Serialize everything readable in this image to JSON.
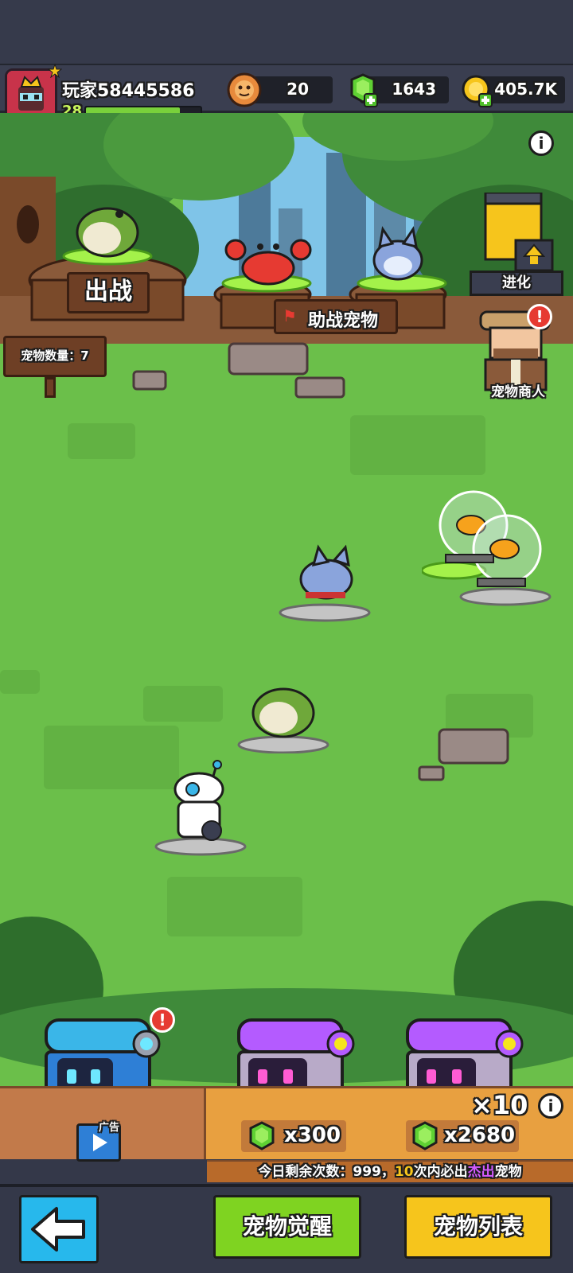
{
  "header": {
    "player_name": "玩家58445586",
    "level": "28",
    "xp_fraction": 0.82,
    "currencies": [
      {
        "icon": "pet-food-icon",
        "value": "20"
      },
      {
        "icon": "green-gem-icon",
        "value": "1643"
      },
      {
        "icon": "gold-coin-icon",
        "value": "405.7K"
      }
    ]
  },
  "scene": {
    "deploy_label": "出战",
    "assist_label": "助战宠物",
    "pet_count_label": "宠物数量：7",
    "evolve_label": "进化",
    "merchant_label": "宠物商人"
  },
  "chests": {
    "ad_label": "广告",
    "price_single": "x300",
    "price_ten": "x2680",
    "ten_multiplier": "×10",
    "remaining_prefix": "今日剩余次数：999，",
    "guarantee_count": "10",
    "guarantee_mid": "次内必出",
    "guarantee_quality": "杰出",
    "guarantee_suffix": "宠物"
  },
  "footer": {
    "awaken_label": "宠物觉醒",
    "list_label": "宠物列表"
  },
  "colors": {
    "grass": "#6bbf4a",
    "wood": "#6e3f25",
    "awaken_btn": "#7fd321",
    "list_btn": "#f6c51c",
    "back_btn": "#27b8ec",
    "highlight_orange": "#f6a21c",
    "highlight_purple": "#d45bff"
  }
}
